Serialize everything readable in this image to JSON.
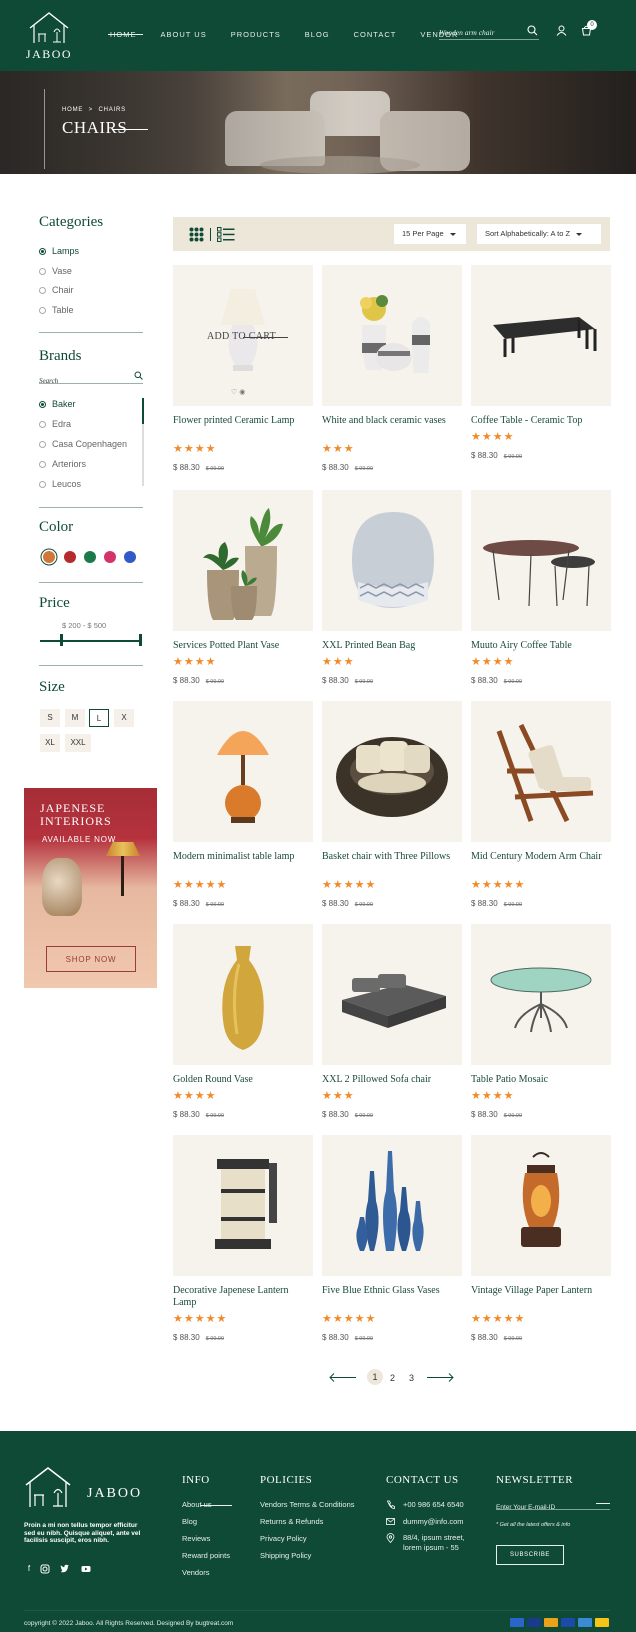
{
  "header": {
    "logo": "JABOO",
    "nav": [
      "HOME",
      "ABOUT US",
      "PRODUCTS",
      "BLOG",
      "CONTACT",
      "VENDOR"
    ],
    "search_placeholder": "Wooden arm chair",
    "cart_count": "0"
  },
  "hero": {
    "breadcrumb_home": "HOME",
    "breadcrumb_sep": ">",
    "breadcrumb_current": "CHAIRS",
    "title": "CHAIRS"
  },
  "sidebar": {
    "categories_title": "Categories",
    "categories": [
      "Lamps",
      "Vase",
      "Chair",
      "Table"
    ],
    "brands_title": "Brands",
    "brands_search": "Search",
    "brands": [
      "Baker",
      "Edra",
      "Casa Copenhagen",
      "Arteriors",
      "Leucos"
    ],
    "color_title": "Color",
    "colors": [
      "#d2763a",
      "#b52a2d",
      "#1c7a4a",
      "#d2336a",
      "#3358c8"
    ],
    "price_title": "Price",
    "price_range": "$ 200  -  $ 500",
    "size_title": "Size",
    "sizes": [
      "S",
      "M",
      "L",
      "X",
      "XL",
      "XXL"
    ],
    "promo_title_1": "JAPENESE",
    "promo_title_2": "INTERIORS",
    "promo_sub": "AVAILABLE NOW",
    "promo_button": "SHOP NOW"
  },
  "toolbar": {
    "per_page": "15 Per Page",
    "sort": "Sort Alphabetically: A to Z"
  },
  "products": [
    {
      "name": "Flower printed Ceramic Lamp",
      "stars": 4,
      "price": "$ 88.30",
      "old_price": "$ 99.99",
      "add_to_cart": "ADD TO CART"
    },
    {
      "name": "White and black ceramic vases",
      "stars": 3,
      "price": "$ 88.30",
      "old_price": "$ 99.99"
    },
    {
      "name": "Coffee Table - Ceramic Top",
      "stars": 4,
      "price": "$ 88.30",
      "old_price": "$ 99.99"
    },
    {
      "name": "Services Potted Plant Vase",
      "stars": 4,
      "price": "$ 88.30",
      "old_price": "$ 99.99"
    },
    {
      "name": "XXL Printed Bean Bag",
      "stars": 3,
      "price": "$ 88.30",
      "old_price": "$ 99.99"
    },
    {
      "name": "Muuto Airy Coffee Table",
      "stars": 4,
      "price": "$ 88.30",
      "old_price": "$ 99.99"
    },
    {
      "name": "Modern minimalist table lamp",
      "stars": 5,
      "price": "$ 88.30",
      "old_price": "$ 99.99"
    },
    {
      "name": "Basket chair with Three Pillows",
      "stars": 5,
      "price": "$ 88.30",
      "old_price": "$ 99.99"
    },
    {
      "name": "Mid Century Modern Arm Chair",
      "stars": 5,
      "price": "$ 88.30",
      "old_price": "$ 99.99"
    },
    {
      "name": "Golden Round Vase",
      "stars": 4,
      "price": "$ 88.30",
      "old_price": "$ 99.99"
    },
    {
      "name": "XXL 2 Pillowed Sofa chair",
      "stars": 3,
      "price": "$ 88.30",
      "old_price": "$ 99.99"
    },
    {
      "name": "Table Patio Mosaic",
      "stars": 4,
      "price": "$ 88.30",
      "old_price": "$ 99.99"
    },
    {
      "name": "Decorative Japenese Lantern Lamp",
      "stars": 5,
      "price": "$ 88.30",
      "old_price": "$ 99.99"
    },
    {
      "name": "Five Blue Ethnic Glass Vases",
      "stars": 5,
      "price": "$ 88.30",
      "old_price": "$ 99.99"
    },
    {
      "name": "Vintage Village Paper Lantern",
      "stars": 5,
      "price": "$ 88.30",
      "old_price": "$ 99.99"
    }
  ],
  "pagination": {
    "pages": [
      "1",
      "2",
      "3"
    ],
    "current": "1"
  },
  "footer": {
    "logo": "JABOO",
    "about": "Proin a mi non tellus tempor efficitur sed eu nibh. Quisque aliquet, ante vel facilisis suscipit, eros nibh.",
    "info_title": "INFO",
    "info_links": [
      "About us",
      "Blog",
      "Reviews",
      "Reward points",
      "Vendors"
    ],
    "policies_title": "POLICIES",
    "policies_links": [
      "Vendors Terms & Conditions",
      "Returns & Refunds",
      "Privacy Policy",
      "Shipping Policy"
    ],
    "contact_title": "CONTACT US",
    "phone": "+00 986 654 6540",
    "email": "dummy@info.com",
    "address_1": "88/4, ipsum street,",
    "address_2": "lorem ipsum - 55",
    "newsletter_title": "NEWSLETTER",
    "newsletter_placeholder": "Enter Your E-mail-ID",
    "newsletter_note": "* Get all the latest offers & info",
    "subscribe": "SUBSCRIBE",
    "copyright": "copyright © 2022 Jaboo.  All Rights Reserved. Designed By bugtreat.com",
    "payments": [
      "#2a66c9",
      "#1a3a8c",
      "#e8a31a",
      "#1c4aa8",
      "#3a8ad6",
      "#f5c518"
    ]
  }
}
